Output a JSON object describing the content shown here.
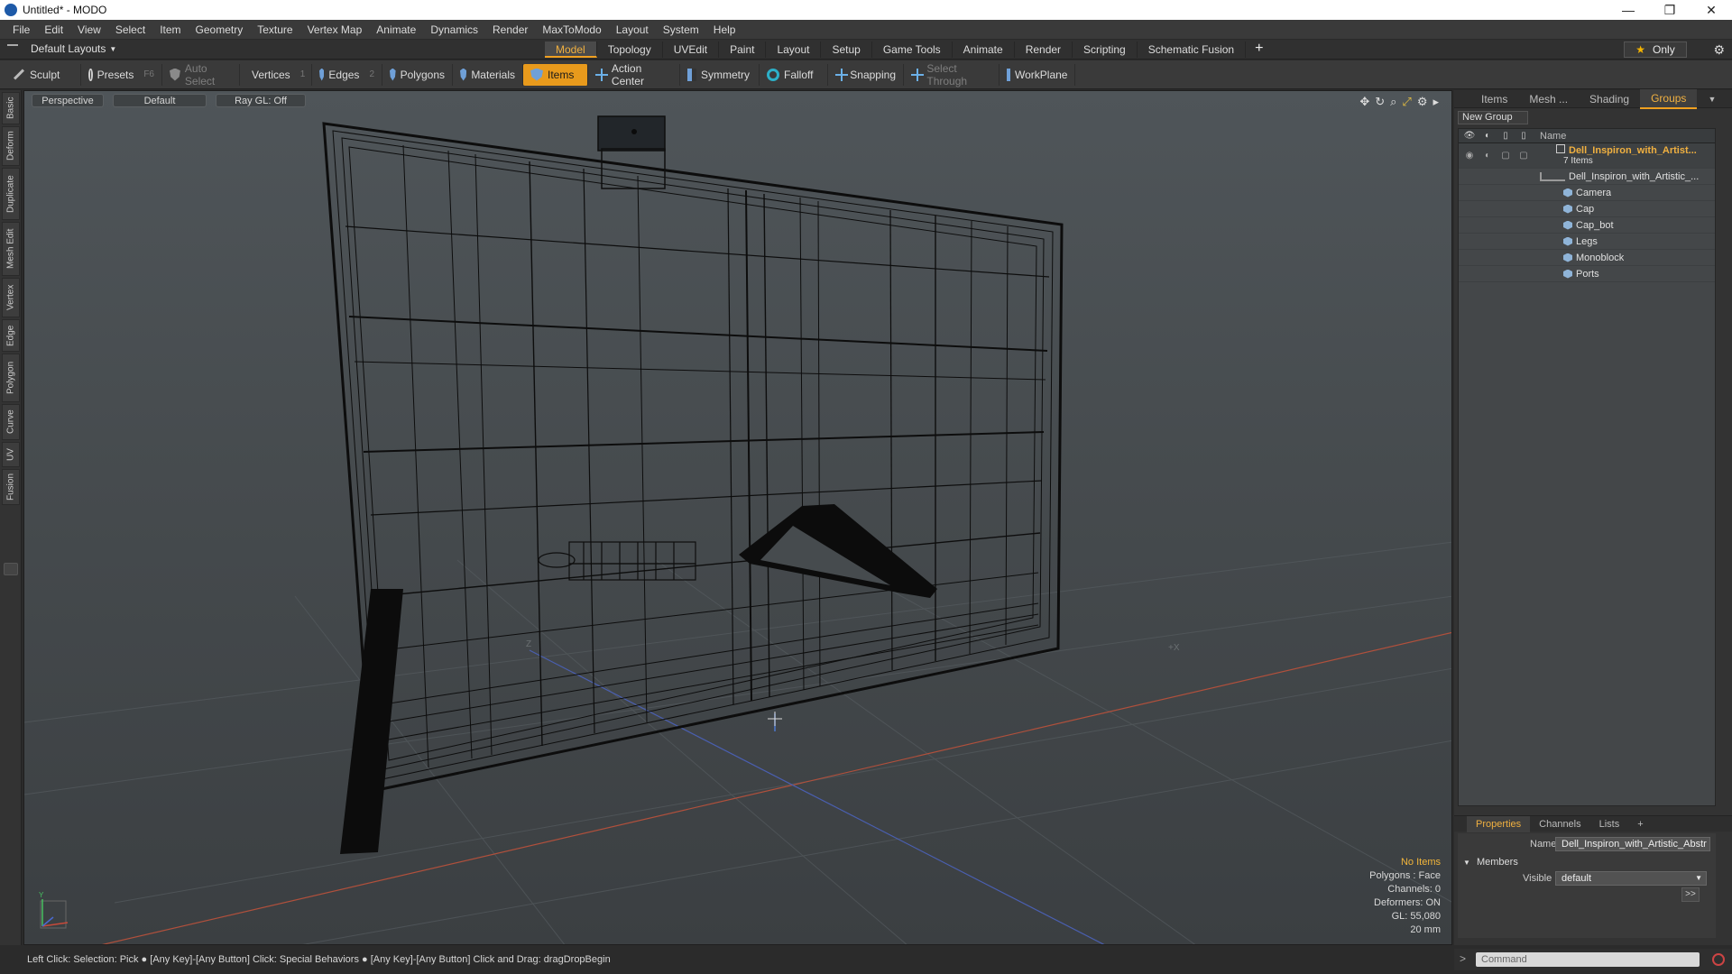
{
  "window": {
    "title": "Untitled* - MODO",
    "minimize": "—",
    "restore": "❐",
    "close": "✕"
  },
  "menu": [
    "File",
    "Edit",
    "View",
    "Select",
    "Item",
    "Geometry",
    "Texture",
    "Vertex Map",
    "Animate",
    "Dynamics",
    "Render",
    "MaxToModo",
    "Layout",
    "System",
    "Help"
  ],
  "layoutbar": {
    "layouts_label": "Default Layouts",
    "tabs": [
      "Model",
      "Topology",
      "UVEdit",
      "Paint",
      "Layout",
      "Setup",
      "Game Tools",
      "Animate",
      "Render",
      "Scripting",
      "Schematic Fusion"
    ],
    "active_tab": "Model",
    "only_label": "Only"
  },
  "toolbar": {
    "sculpt": "Sculpt",
    "presets": "Presets",
    "presets_key": "F6",
    "auto_select": "Auto Select",
    "vertices": "Vertices",
    "vertices_key": "1",
    "edges": "Edges",
    "edges_key": "2",
    "polygons": "Polygons",
    "materials": "Materials",
    "items": "Items",
    "action_center": "Action Center",
    "symmetry": "Symmetry",
    "falloff": "Falloff",
    "snapping": "Snapping",
    "select_through": "Select Through",
    "workplane": "WorkPlane"
  },
  "left_tabs": [
    "Basic",
    "Deform",
    "Duplicate",
    "Mesh Edit",
    "Vertex",
    "Edge",
    "Polygon",
    "Curve",
    "UV",
    "Fusion"
  ],
  "viewport": {
    "view": "Perspective",
    "shading": "Default",
    "raygl": "Ray GL: Off",
    "stats": {
      "no_items": "No Items",
      "polygons": "Polygons : Face",
      "channels": "Channels: 0",
      "deformers": "Deformers: ON",
      "gl": "GL: 55,080",
      "scale": "20 mm"
    },
    "axis_labels": {
      "z": "Z",
      "x": "+X",
      "y": "Y"
    }
  },
  "right_panel": {
    "tabs": [
      "Items",
      "Mesh ...",
      "Shading",
      "Groups"
    ],
    "active_tab": "Groups",
    "new_group": "New Group",
    "name_header": "Name",
    "group": {
      "name": "Dell_Inspiron_with_Artist...",
      "count": "7 Items"
    },
    "items": [
      "Dell_Inspiron_with_Artistic_...",
      "Camera",
      "Cap",
      "Cap_bot",
      "Legs",
      "Monoblock",
      "Ports"
    ]
  },
  "properties": {
    "tabs": [
      "Properties",
      "Channels",
      "Lists"
    ],
    "active_tab": "Properties",
    "name_label": "Name",
    "name_value": "Dell_Inspiron_with_Artistic_Abstr",
    "members_label": "Members",
    "visible_label": "Visible",
    "visible_value": "default",
    "arrow": ">>"
  },
  "command": {
    "placeholder": "Command",
    "prompt": ">"
  },
  "statusbar": "Left Click: Selection: Pick ● [Any Key]-[Any Button] Click: Special Behaviors ● [Any Key]-[Any Button] Click and Drag: dragDropBegin"
}
